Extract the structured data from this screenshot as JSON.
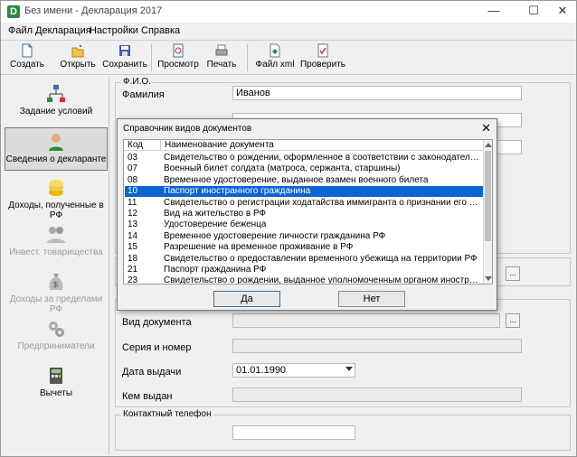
{
  "window": {
    "title": "Без имени - Декларация 2017",
    "logo": "D"
  },
  "menu": [
    "Файл",
    "Декларация",
    "Настройки",
    "Справка"
  ],
  "toolbar": {
    "create": "Создать",
    "open": "Открыть",
    "save": "Сохранить",
    "preview": "Просмотр",
    "print": "Печать",
    "xml": "Файл xml",
    "check": "Проверить"
  },
  "sidebar": {
    "items": [
      "Задание условий",
      "Сведения о декларанте",
      "Доходы, полученные в РФ",
      "Инвест. товарищества",
      "Доходы за пределами РФ",
      "Предприниматели",
      "Вычеты"
    ]
  },
  "form": {
    "fio_group": "Ф.И.О.",
    "surname_label": "Фамилия",
    "surname_value": "Иванов",
    "doc_type_label": "Вид документа",
    "series_label": "Серия и номер",
    "issue_date_label": "Дата выдачи",
    "issue_date_value": "01.01.1990",
    "issued_by_label": "Кем выдан",
    "phone_group": "Контактный телефон",
    "browse_btn": "..."
  },
  "dialog": {
    "title": "Справочник видов документов",
    "col_code": "Код",
    "col_name": "Наименование документа",
    "yes": "Да",
    "no": "Нет",
    "rows": [
      {
        "code": "03",
        "name": "Свидетельство о рождении, оформленное в соответствии с законодательством РФ"
      },
      {
        "code": "07",
        "name": "Военный билет солдата (матроса, сержанта, старшины)"
      },
      {
        "code": "08",
        "name": "Временное удостоверение, выданное взамен военного билета"
      },
      {
        "code": "10",
        "name": "Паспорт иностранного гражданина"
      },
      {
        "code": "11",
        "name": "Свидетельство о регистрации ходатайства иммигранта о признании его беженцем..."
      },
      {
        "code": "12",
        "name": "Вид на жительство в РФ"
      },
      {
        "code": "13",
        "name": "Удостоверение беженца"
      },
      {
        "code": "14",
        "name": "Временное удостоверение личности гражданина РФ"
      },
      {
        "code": "15",
        "name": "Разрешение на временное проживание в РФ"
      },
      {
        "code": "18",
        "name": "Свидетельство о предоставлении временного убежища на территории РФ"
      },
      {
        "code": "21",
        "name": "Паспорт гражданина РФ"
      },
      {
        "code": "23",
        "name": "Свидетельство о рождении, выданное уполномоченным органом иностранного гос..."
      }
    ],
    "selected_index": 3
  },
  "colors": {
    "selection": "#0a64d2",
    "logo": "#2b8a3e"
  },
  "icons": [
    "new-document-icon",
    "open-folder-icon",
    "floppy-disk-icon",
    "preview-icon",
    "printer-icon",
    "xml-file-icon",
    "check-document-icon"
  ]
}
